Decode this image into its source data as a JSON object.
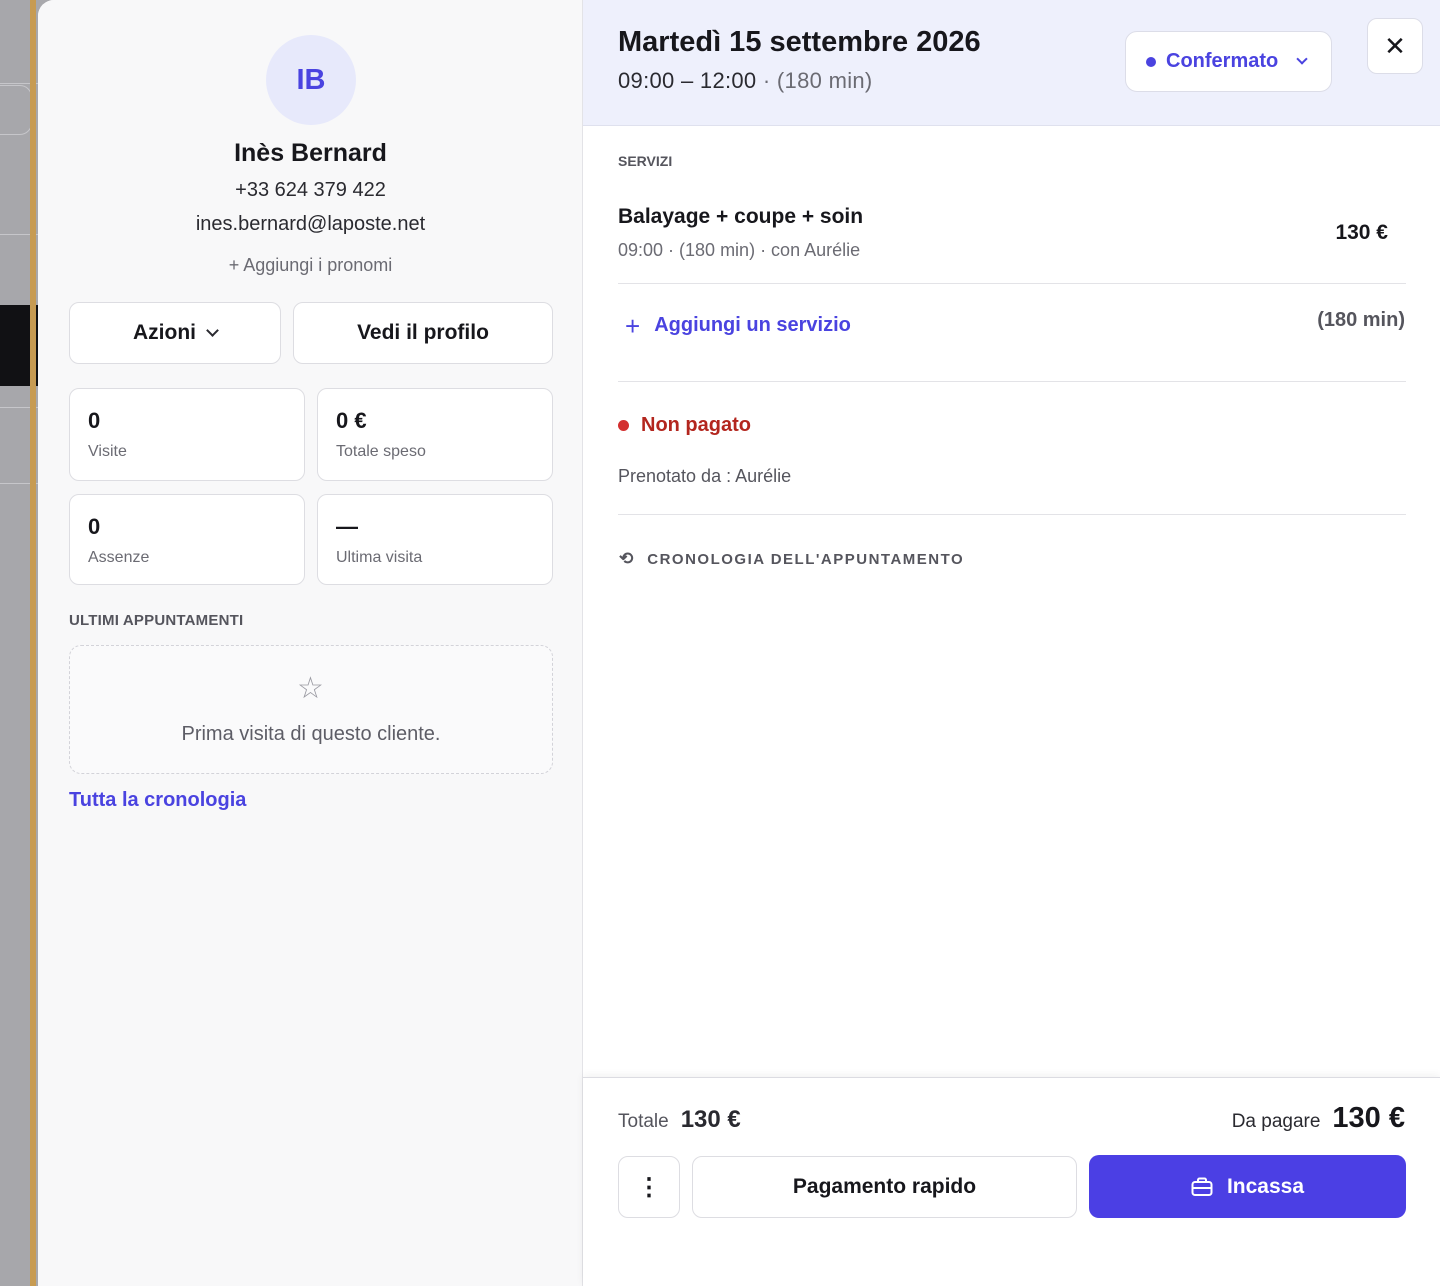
{
  "client": {
    "initials": "IB",
    "name": "Inès Bernard",
    "phone": "+33 624 379 422",
    "email": "ines.bernard@laposte.net",
    "add_pronouns": "+ Aggiungi i pronomi"
  },
  "actions": {
    "actions_label": "Azioni",
    "profile_label": "Vedi il profilo"
  },
  "stats": [
    {
      "value": "0",
      "label": "Visite"
    },
    {
      "value": "0 €",
      "label": "Totale speso"
    },
    {
      "value": "0",
      "label": "Assenze"
    },
    {
      "value": "—",
      "label": "Ultima visita"
    }
  ],
  "recent": {
    "title": "ULTIMI APPUNTAMENTI",
    "empty_message": "Prima visita di questo cliente.",
    "history_link": "Tutta la cronologia"
  },
  "appointment": {
    "date": "Martedì 15 settembre 2026",
    "time_range": "09:00 – 12:00",
    "duration": "· (180 min)",
    "status": "Confermato",
    "close_symbol": "✕"
  },
  "services": {
    "title": "SERVIZI",
    "items": [
      {
        "name": "Balayage + coupe + soin",
        "meta": "09:00 · (180 min) · con Aurélie",
        "price": "130 €"
      }
    ],
    "add_label": "Aggiungi un servizio",
    "total_duration": "(180 min)"
  },
  "payment": {
    "status": "Non pagato",
    "booked_by": "Prenotato da : Aurélie"
  },
  "history_label": "CRONOLOGIA DELL'APPUNTAMENTO",
  "footer": {
    "total_label": "Totale",
    "total_value": "130 €",
    "due_label": "Da pagare",
    "due_value": "130 €",
    "more_symbol": "⋮",
    "quick_pay": "Pagamento rapido",
    "cash": "Incassa"
  },
  "colors": {
    "accent": "#4a43e0",
    "danger": "#d32f2f",
    "header_bg": "#eef0fc"
  }
}
